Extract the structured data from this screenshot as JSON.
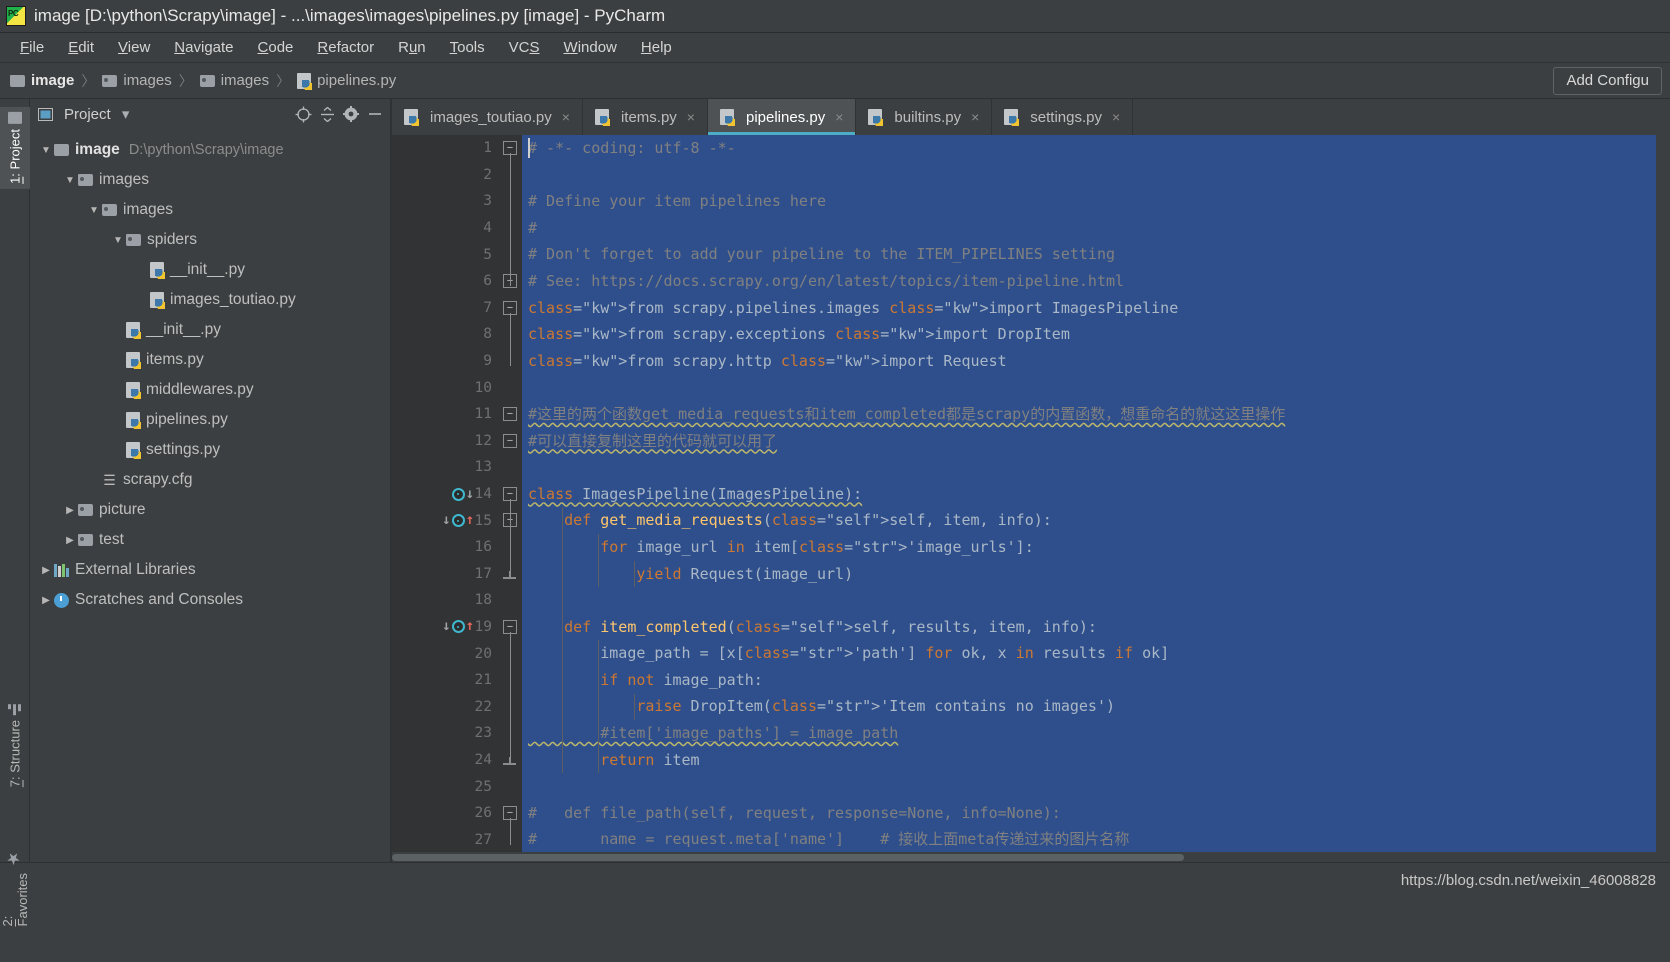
{
  "window": {
    "title": "image [D:\\python\\Scrapy\\image] - ...\\images\\images\\pipelines.py [image] - PyCharm",
    "logo_text": "PC"
  },
  "menubar": {
    "items": [
      {
        "label": "File",
        "mnemonic": "F"
      },
      {
        "label": "Edit",
        "mnemonic": "E"
      },
      {
        "label": "View",
        "mnemonic": "V"
      },
      {
        "label": "Navigate",
        "mnemonic": "N"
      },
      {
        "label": "Code",
        "mnemonic": "C"
      },
      {
        "label": "Refactor",
        "mnemonic": "R"
      },
      {
        "label": "Run",
        "mnemonic": "u"
      },
      {
        "label": "Tools",
        "mnemonic": "T"
      },
      {
        "label": "VCS",
        "mnemonic": "S"
      },
      {
        "label": "Window",
        "mnemonic": "W"
      },
      {
        "label": "Help",
        "mnemonic": "H"
      }
    ]
  },
  "navbar": {
    "crumbs": [
      {
        "label": "image",
        "icon": "folder-icon"
      },
      {
        "label": "images",
        "icon": "folder-icon"
      },
      {
        "label": "images",
        "icon": "folder-icon"
      },
      {
        "label": "pipelines.py",
        "icon": "python-file-icon"
      }
    ],
    "separator": "〉",
    "add_config_label": "Add Configu"
  },
  "toolstrip": {
    "tabs": [
      {
        "label": "1: Project",
        "mnemonic": "1",
        "icon": "project-icon",
        "selected": true
      },
      {
        "label": "7: Structure",
        "mnemonic": "7",
        "icon": "structure-icon",
        "selected": false
      },
      {
        "label": "2: Favorites",
        "mnemonic": "2",
        "icon": "star-icon",
        "selected": false
      }
    ]
  },
  "project_panel": {
    "title": "Project",
    "dropdown_glyph": "▾",
    "toolbar_icons": [
      "locate-icon",
      "collapse-all-icon",
      "gear-icon",
      "hide-icon"
    ],
    "tree": [
      {
        "indent": 0,
        "arrow": "▼",
        "icon": "folder-icon",
        "label": "image",
        "bold": true,
        "path": "D:\\python\\Scrapy\\image"
      },
      {
        "indent": 1,
        "arrow": "▼",
        "icon": "folder-icon",
        "label": "images",
        "bold": false,
        "path": ""
      },
      {
        "indent": 2,
        "arrow": "▼",
        "icon": "folder-icon",
        "label": "images",
        "bold": false,
        "path": ""
      },
      {
        "indent": 3,
        "arrow": "▼",
        "icon": "folder-icon",
        "label": "spiders",
        "bold": false,
        "path": ""
      },
      {
        "indent": 4,
        "arrow": "",
        "icon": "python-file-icon",
        "label": "__init__.py",
        "bold": false,
        "path": ""
      },
      {
        "indent": 4,
        "arrow": "",
        "icon": "python-file-icon",
        "label": "images_toutiao.py",
        "bold": false,
        "path": ""
      },
      {
        "indent": 3,
        "arrow": "",
        "icon": "python-file-icon",
        "label": "__init__.py",
        "bold": false,
        "path": ""
      },
      {
        "indent": 3,
        "arrow": "",
        "icon": "python-file-icon",
        "label": "items.py",
        "bold": false,
        "path": ""
      },
      {
        "indent": 3,
        "arrow": "",
        "icon": "python-file-icon",
        "label": "middlewares.py",
        "bold": false,
        "path": ""
      },
      {
        "indent": 3,
        "arrow": "",
        "icon": "python-file-icon",
        "label": "pipelines.py",
        "bold": false,
        "path": ""
      },
      {
        "indent": 3,
        "arrow": "",
        "icon": "python-file-icon",
        "label": "settings.py",
        "bold": false,
        "path": ""
      },
      {
        "indent": 2,
        "arrow": "",
        "icon": "config-file-icon",
        "label": "scrapy.cfg",
        "bold": false,
        "path": ""
      },
      {
        "indent": 1,
        "arrow": "▶",
        "icon": "folder-icon",
        "label": "picture",
        "bold": false,
        "path": ""
      },
      {
        "indent": 1,
        "arrow": "▶",
        "icon": "folder-icon",
        "label": "test",
        "bold": false,
        "path": ""
      },
      {
        "indent": 0,
        "arrow": "▶",
        "icon": "external-libraries-icon",
        "label": "External Libraries",
        "bold": false,
        "path": ""
      },
      {
        "indent": 0,
        "arrow": "▶",
        "icon": "scratches-icon",
        "label": "Scratches and Consoles",
        "bold": false,
        "path": ""
      }
    ]
  },
  "editor": {
    "tabs": [
      {
        "label": "images_toutiao.py",
        "active": false,
        "close_glyph": "×"
      },
      {
        "label": "items.py",
        "active": false,
        "close_glyph": "×"
      },
      {
        "label": "pipelines.py",
        "active": true,
        "close_glyph": "×"
      },
      {
        "label": "builtins.py",
        "active": false,
        "close_glyph": "×"
      },
      {
        "label": "settings.py",
        "active": false,
        "close_glyph": "×"
      }
    ],
    "line_numbers": [
      1,
      2,
      3,
      4,
      5,
      6,
      7,
      8,
      9,
      10,
      11,
      12,
      13,
      14,
      15,
      16,
      17,
      18,
      19,
      20,
      21,
      22,
      23,
      24,
      25,
      26,
      27
    ],
    "code_lines": [
      {
        "n": 1,
        "text": "# -*- coding: utf-8 -*-",
        "type": "comment"
      },
      {
        "n": 2,
        "text": "",
        "type": "blank"
      },
      {
        "n": 3,
        "text": "# Define your item pipelines here",
        "type": "comment"
      },
      {
        "n": 4,
        "text": "#",
        "type": "comment"
      },
      {
        "n": 5,
        "text": "# Don't forget to add your pipeline to the ITEM_PIPELINES setting",
        "type": "comment"
      },
      {
        "n": 6,
        "text": "# See: https://docs.scrapy.org/en/latest/topics/item-pipeline.html",
        "type": "comment"
      },
      {
        "n": 7,
        "text": "from scrapy.pipelines.images import ImagesPipeline",
        "type": "code"
      },
      {
        "n": 8,
        "text": "from scrapy.exceptions import DropItem",
        "type": "code"
      },
      {
        "n": 9,
        "text": "from scrapy.http import Request",
        "type": "code"
      },
      {
        "n": 10,
        "text": "",
        "type": "blank"
      },
      {
        "n": 11,
        "text": "#这里的两个函数get_media_requests和item_completed都是scrapy的内置函数，想重命名的就这这里操作",
        "type": "comment-wavy"
      },
      {
        "n": 12,
        "text": "#可以直接复制这里的代码就可以用了",
        "type": "comment-wavy"
      },
      {
        "n": 13,
        "text": "",
        "type": "blank"
      },
      {
        "n": 14,
        "text": "class ImagesPipeline(ImagesPipeline):",
        "type": "code-wavy"
      },
      {
        "n": 15,
        "text": "    def get_media_requests(self, item, info):",
        "type": "code"
      },
      {
        "n": 16,
        "text": "        for image_url in item['image_urls']:",
        "type": "code"
      },
      {
        "n": 17,
        "text": "            yield Request(image_url)",
        "type": "code"
      },
      {
        "n": 18,
        "text": "",
        "type": "blank"
      },
      {
        "n": 19,
        "text": "    def item_completed(self, results, item, info):",
        "type": "code"
      },
      {
        "n": 20,
        "text": "        image_path = [x['path'] for ok, x in results if ok]",
        "type": "code"
      },
      {
        "n": 21,
        "text": "        if not image_path:",
        "type": "code"
      },
      {
        "n": 22,
        "text": "            raise DropItem('Item contains no images')",
        "type": "code"
      },
      {
        "n": 23,
        "text": "        #item['image_paths'] = image_path",
        "type": "comment-wavy"
      },
      {
        "n": 24,
        "text": "        return item",
        "type": "code"
      },
      {
        "n": 25,
        "text": "",
        "type": "blank"
      },
      {
        "n": 26,
        "text": "#   def file_path(self, request, response=None, info=None):",
        "type": "comment"
      },
      {
        "n": 27,
        "text": "#       name = request.meta['name']    # 接收上面meta传递过来的图片名称",
        "type": "comment"
      }
    ],
    "gutter_markers": [
      {
        "line": 14,
        "icons": [
          "overridden-method-icon",
          "arrow-down"
        ]
      },
      {
        "line": 15,
        "icons": [
          "arrow-down",
          "overridden-method-icon",
          "arrow-up"
        ]
      },
      {
        "line": 19,
        "icons": [
          "arrow-down",
          "overridden-method-icon",
          "arrow-up"
        ]
      }
    ],
    "selection_active": true
  },
  "statusbar": {
    "url": "https://blog.csdn.net/weixin_46008828"
  },
  "colors": {
    "background": "#3c3f41",
    "editor_bg": "#2b2b2b",
    "selection": "#2f4f8c",
    "accent": "#4eadc6",
    "keyword": "#cc7832",
    "string": "#6a8759",
    "comment": "#808080",
    "function": "#ffc66d",
    "self_param": "#94558d",
    "text": "#a9b7c6"
  }
}
